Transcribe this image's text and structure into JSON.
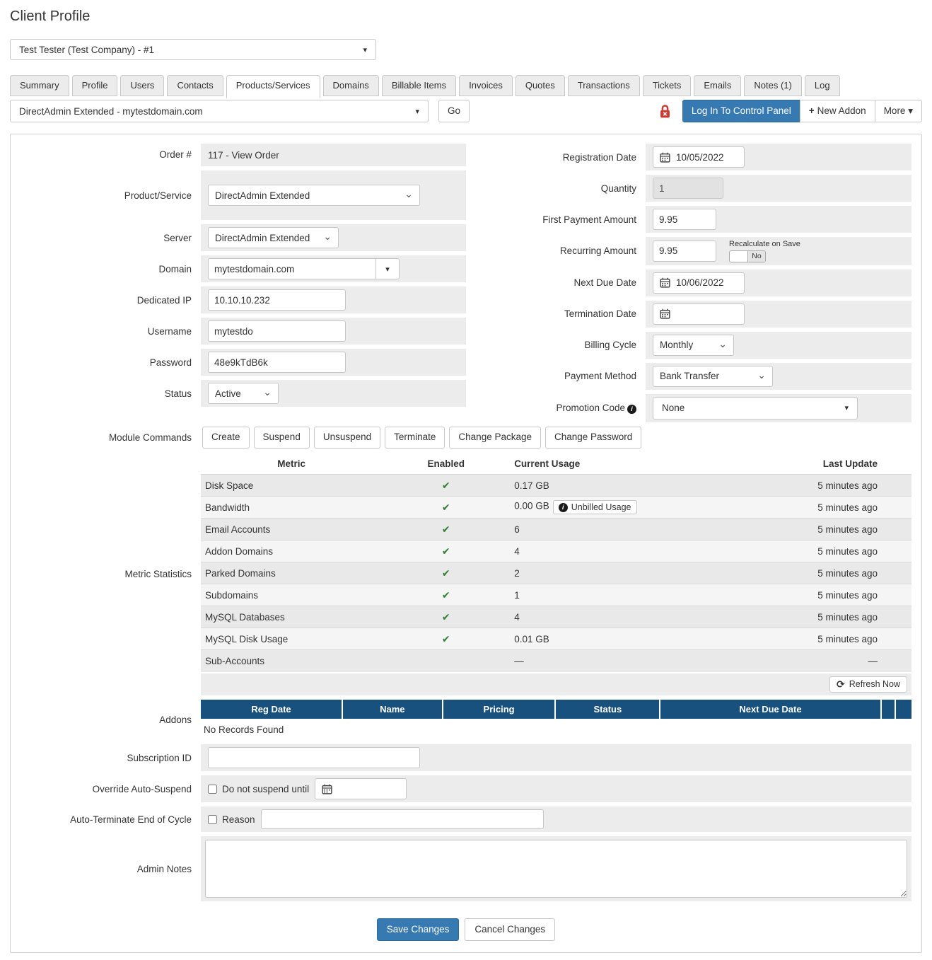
{
  "page": {
    "title": "Client Profile"
  },
  "client_select": {
    "value": "Test Tester (Test Company) - #1"
  },
  "tabs": [
    {
      "label": "Summary"
    },
    {
      "label": "Profile"
    },
    {
      "label": "Users"
    },
    {
      "label": "Contacts"
    },
    {
      "label": "Products/Services"
    },
    {
      "label": "Domains"
    },
    {
      "label": "Billable Items"
    },
    {
      "label": "Invoices"
    },
    {
      "label": "Quotes"
    },
    {
      "label": "Transactions"
    },
    {
      "label": "Tickets"
    },
    {
      "label": "Emails"
    },
    {
      "label": "Notes (1)"
    },
    {
      "label": "Log"
    }
  ],
  "toolbar": {
    "product_select": "DirectAdmin Extended - mytestdomain.com",
    "go_label": "Go",
    "login_label": "Log In To Control Panel",
    "new_addon_label": "New Addon",
    "more_label": "More"
  },
  "form_left": {
    "order": {
      "label": "Order #",
      "value": "117 - View Order"
    },
    "product": {
      "label": "Product/Service",
      "value": "DirectAdmin Extended"
    },
    "server": {
      "label": "Server",
      "value": "DirectAdmin Extended"
    },
    "domain": {
      "label": "Domain",
      "value": "mytestdomain.com"
    },
    "dedicated_ip": {
      "label": "Dedicated IP",
      "value": "10.10.10.232"
    },
    "username": {
      "label": "Username",
      "value": "mytestdo"
    },
    "password": {
      "label": "Password",
      "value": "48e9kTdB6k"
    },
    "status": {
      "label": "Status",
      "value": "Active"
    },
    "module_commands": {
      "label": "Module Commands",
      "buttons": [
        "Create",
        "Suspend",
        "Unsuspend",
        "Terminate",
        "Change Package",
        "Change Password"
      ]
    }
  },
  "form_right": {
    "registration_date": {
      "label": "Registration Date",
      "value": "10/05/2022"
    },
    "quantity": {
      "label": "Quantity",
      "value": "1"
    },
    "first_payment": {
      "label": "First Payment Amount",
      "value": "9.95"
    },
    "recurring": {
      "label": "Recurring Amount",
      "value": "9.95",
      "note": "Recalculate on Save",
      "toggle": "No"
    },
    "next_due": {
      "label": "Next Due Date",
      "value": "10/06/2022"
    },
    "termination": {
      "label": "Termination Date",
      "value": ""
    },
    "billing_cycle": {
      "label": "Billing Cycle",
      "value": "Monthly"
    },
    "payment_method": {
      "label": "Payment Method",
      "value": "Bank Transfer"
    },
    "promotion": {
      "label": "Promotion Code",
      "value": "None"
    }
  },
  "metrics": {
    "label": "Metric Statistics",
    "headers": [
      "Metric",
      "Enabled",
      "Current Usage",
      "Last Update"
    ],
    "rows": [
      {
        "name": "Disk Space",
        "mark": "✔",
        "usage": "0.17 GB",
        "updated": "5 minutes ago"
      },
      {
        "name": "Bandwidth",
        "mark": "✔",
        "usage": "0.00 GB",
        "badge": "Unbilled Usage",
        "updated": "5 minutes ago"
      },
      {
        "name": "Email Accounts",
        "mark": "✔",
        "usage": "6",
        "updated": "5 minutes ago"
      },
      {
        "name": "Addon Domains",
        "mark": "✔",
        "usage": "4",
        "updated": "5 minutes ago"
      },
      {
        "name": "Parked Domains",
        "mark": "✔",
        "usage": "2",
        "updated": "5 minutes ago"
      },
      {
        "name": "Subdomains",
        "mark": "✔",
        "usage": "1",
        "updated": "5 minutes ago"
      },
      {
        "name": "MySQL Databases",
        "mark": "✔",
        "usage": "4",
        "updated": "5 minutes ago"
      },
      {
        "name": "MySQL Disk Usage",
        "mark": "✔",
        "usage": "0.01 GB",
        "updated": "5 minutes ago"
      },
      {
        "name": "Sub-Accounts",
        "mark": "",
        "usage": "—",
        "updated": "—"
      }
    ],
    "refresh_label": "Refresh Now"
  },
  "addons": {
    "label": "Addons",
    "headers": [
      "Reg Date",
      "Name",
      "Pricing",
      "Status",
      "Next Due Date"
    ],
    "empty": "No Records Found"
  },
  "bottom": {
    "subscription": {
      "label": "Subscription ID",
      "value": ""
    },
    "override": {
      "label": "Override Auto-Suspend",
      "checkbox_label": "Do not suspend until"
    },
    "auto_terminate": {
      "label": "Auto-Terminate End of Cycle",
      "checkbox_label": "Reason",
      "value": ""
    },
    "admin_notes": {
      "label": "Admin Notes",
      "value": ""
    }
  },
  "footer": {
    "save": "Save Changes",
    "cancel": "Cancel Changes"
  },
  "icons": {
    "caret": "▾",
    "chevron": "⌄",
    "check": "✔",
    "refresh": "⟳",
    "plus": "+",
    "info": "i"
  },
  "colors": {
    "accent_blue": "#377ab2",
    "table_header_blue": "#18517e",
    "check_green": "#2f7d33",
    "lock_red": "#cc3b33"
  }
}
